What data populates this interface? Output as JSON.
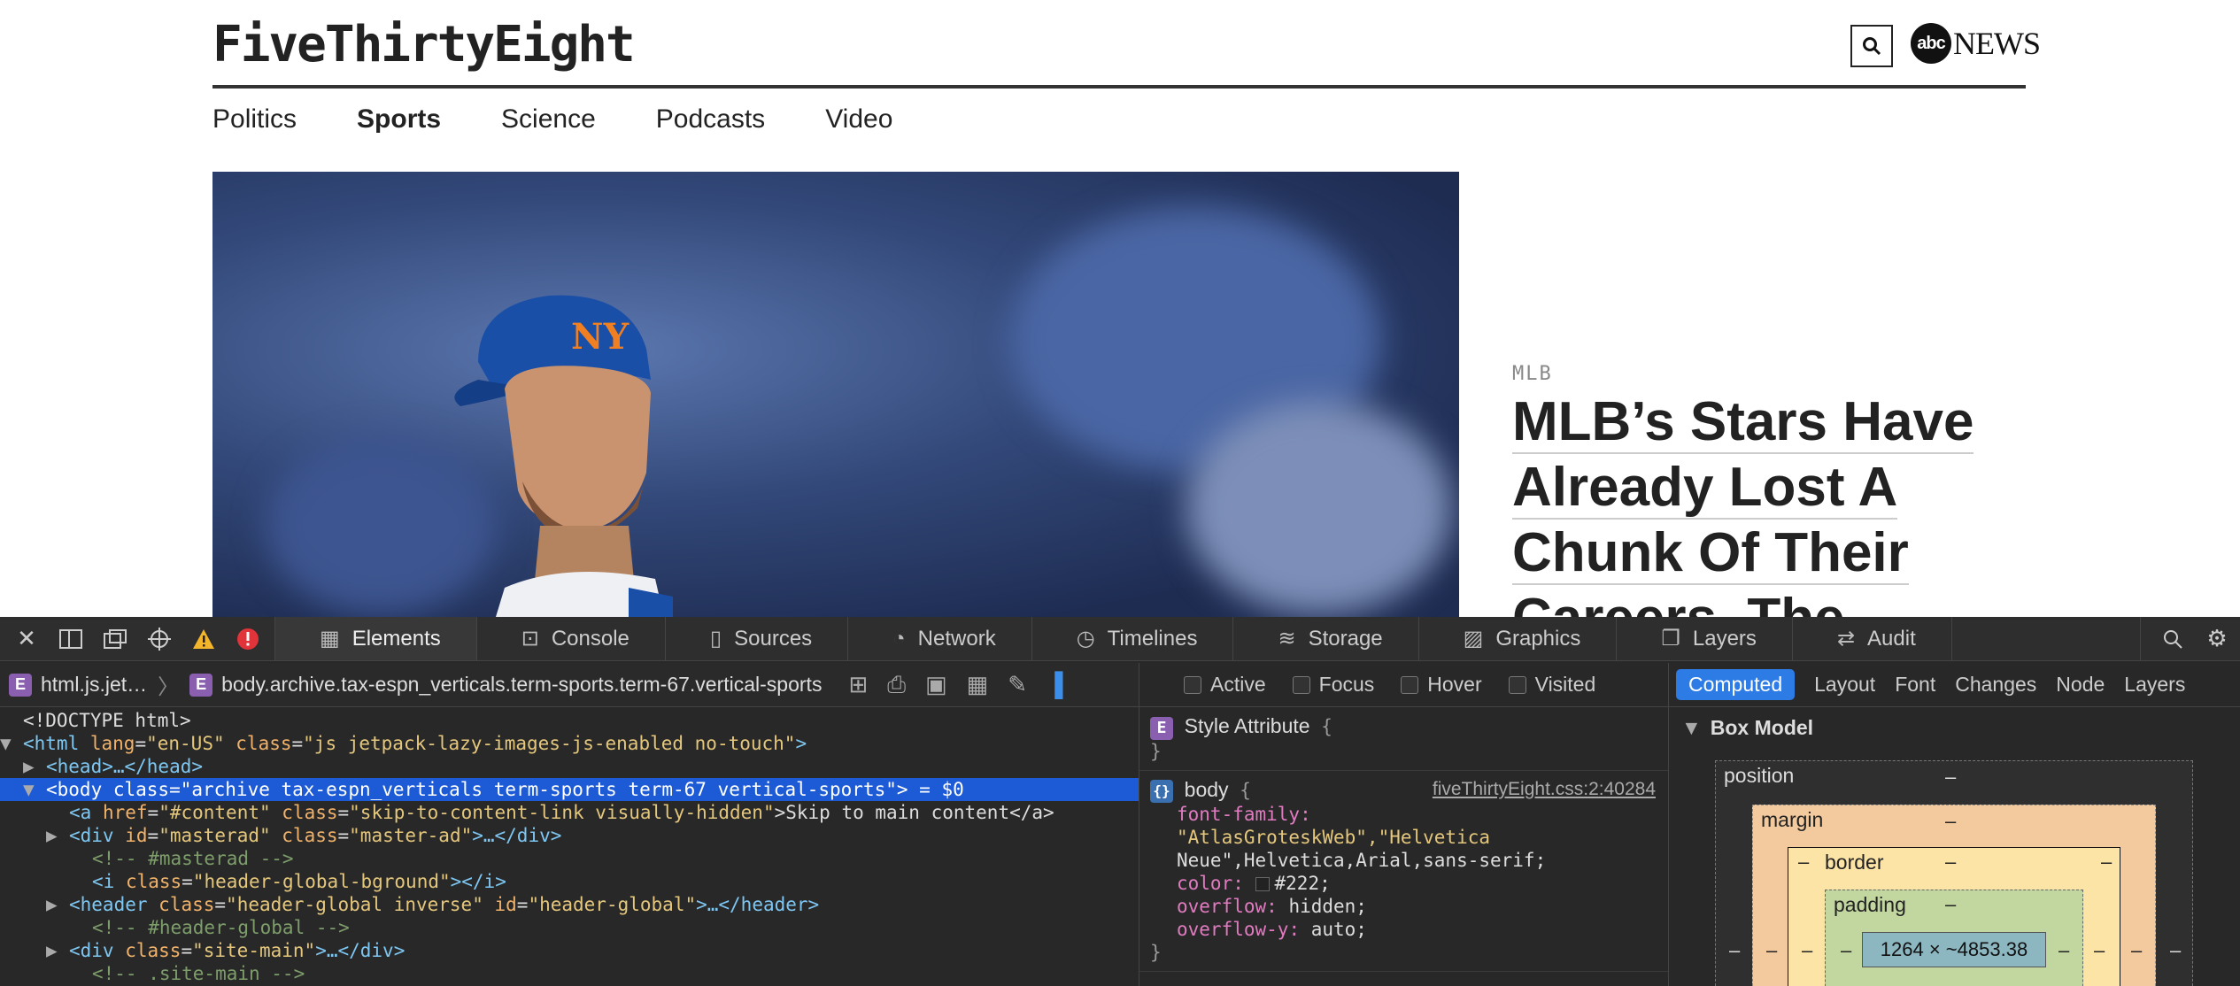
{
  "site": {
    "logo": "FiveThirtyEight",
    "abc_badge": "abc",
    "abc_news": "NEWS",
    "nav": [
      "Politics",
      "Sports",
      "Science",
      "Podcasts",
      "Video"
    ],
    "kicker": "MLB",
    "headline": [
      "MLB’s Stars Have",
      "Already Lost A",
      "Chunk Of Their",
      "Careers. The"
    ]
  },
  "devtools": {
    "tabs": [
      "Elements",
      "Console",
      "Sources",
      "Network",
      "Timelines",
      "Storage",
      "Graphics",
      "Layers",
      "Audit"
    ],
    "breadcrumb": {
      "first": "html.js.jet…",
      "second": "body.archive.tax-espn_verticals.term-sports.term-67.vertical-sports",
      "badge": "E"
    },
    "dom": {
      "doctype": "<!DOCTYPE html>",
      "html_open": "<html",
      "html_lang_name": "lang",
      "html_lang_val": "\"en-US\"",
      "html_class_name": "class",
      "html_class_val": "\"js jetpack-lazy-images-js-enabled no-touch\"",
      "head": "<head>…</head>",
      "body_line": "<body class=\"archive tax-espn_verticals term-sports term-67 vertical-sports\"> = $0",
      "a_open": "<a",
      "a_href_name": "href",
      "a_href_val": "\"#content\"",
      "a_class_name": "class",
      "a_class_val": "\"skip-to-content-link visually-hidden\"",
      "a_text": ">Skip to main content</a>",
      "div_masterad_open": "<div",
      "div_masterad_id_name": "id",
      "div_masterad_id_val": "\"masterad\"",
      "div_masterad_class_name": "class",
      "div_masterad_class_val": "\"master-ad\"",
      "div_masterad_close": ">…</div>",
      "comment_masterad": "<!-- #masterad -->",
      "i_open": "<i",
      "i_class_name": "class",
      "i_class_val": "\"header-global-bground\"",
      "i_close": "></i>",
      "header_open": "<header",
      "header_class_name": "class",
      "header_class_val": "\"header-global inverse\"",
      "header_id_name": "id",
      "header_id_val": "\"header-global\"",
      "header_close": ">…</header>",
      "comment_header": "<!-- #header-global -->",
      "div_site_open": "<div",
      "div_site_class_name": "class",
      "div_site_class_val": "\"site-main\"",
      "div_site_close": ">…</div>",
      "comment_site": "<!-- .site-main -->"
    },
    "states": [
      "Active",
      "Focus",
      "Hover",
      "Visited"
    ],
    "styles": {
      "attr_label": "Style Attribute",
      "attr_open": "{",
      "attr_close": "}",
      "selector": "body",
      "source": "fiveThirtyEight.css:2:40284",
      "font_family_prop": "font-family",
      "font_family_val_1": "\"AtlasGroteskWeb\",\"Helvetica",
      "font_family_val_2": "Neue\",Helvetica,Arial,sans-serif;",
      "color_prop": "color",
      "color_val": "#222;",
      "overflow_prop": "overflow",
      "overflow_val": "hidden;",
      "overflow_y_prop": "overflow-y",
      "overflow_y_val": "auto;",
      "close": "}"
    },
    "sidebar": {
      "tabs": [
        "Computed",
        "Layout",
        "Font",
        "Changes",
        "Node",
        "Layers"
      ],
      "section": "Box Model",
      "position_label": "position",
      "margin_label": "margin",
      "border_label": "border",
      "padding_label": "padding",
      "dash": "–",
      "content_size": "1264 × ~4853.38"
    }
  }
}
